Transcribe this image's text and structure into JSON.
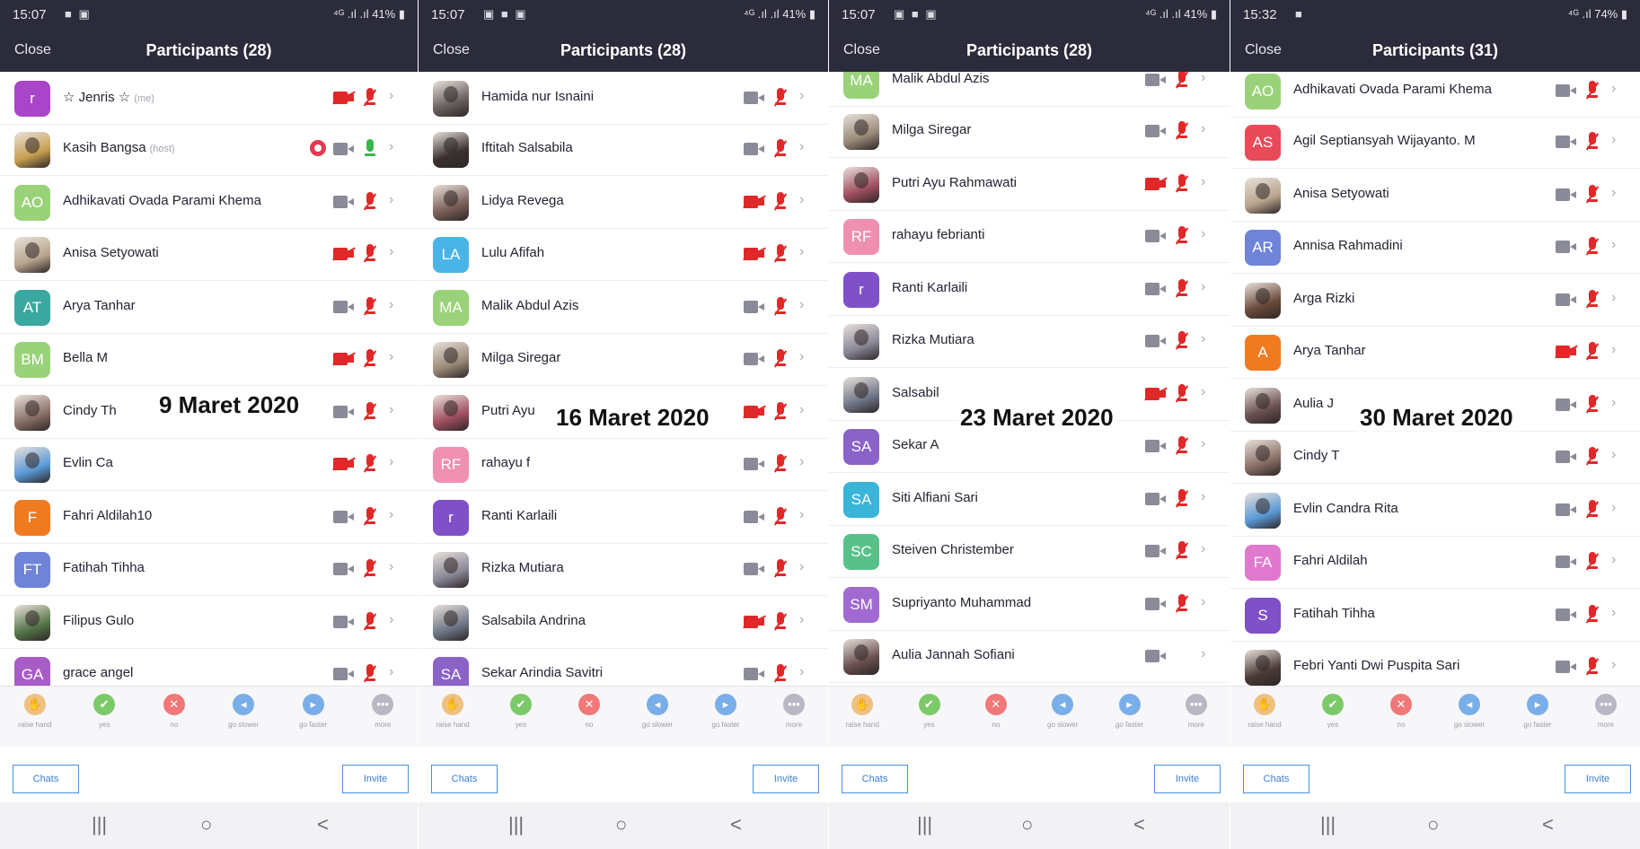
{
  "colors": {
    "header_bg": "#2b2b3b",
    "muted_red": "#e02828",
    "unmuted_green": "#3ab54a",
    "video_gray": "#8a8a98",
    "button_blue": "#3b7fd0",
    "record_red": "#e53950"
  },
  "icons": {
    "video": "video-camera-icon",
    "video_off": "video-camera-off-icon",
    "mic_muted": "microphone-muted-icon",
    "mic_on": "microphone-icon",
    "chevron": "chevron-right-icon",
    "record": "record-icon",
    "home": "home-icon",
    "back": "back-icon",
    "recents": "recents-icon"
  },
  "panels": [
    {
      "status_time": "15:07",
      "status_icons": "■ ▣",
      "status_signal": "⁴ᴳ .ıl .ıl 41% ▮",
      "close_label": "Close",
      "title": "Participants (28)",
      "date_overlay": "9 Maret 2020",
      "participants": [
        {
          "name": "☆ Jenris ☆",
          "tag": "(me)",
          "avatar": "r",
          "color": "#a845c8",
          "video": "off",
          "mic": "muted"
        },
        {
          "name": "Kasih Bangsa",
          "tag": "(host)",
          "avatar": "",
          "color": "#c8a050",
          "video": "on",
          "mic": "on",
          "record": true
        },
        {
          "name": "Adhikavati Ovada Parami Khema",
          "avatar": "AO",
          "color": "#9ad27a",
          "video": "on",
          "mic": "muted"
        },
        {
          "name": "Anisa Setyowati",
          "avatar": "",
          "color": "#b9a58d",
          "video": "off",
          "mic": "muted"
        },
        {
          "name": "Arya Tanhar",
          "avatar": "AT",
          "color": "#3aa8a0",
          "video": "on",
          "mic": "muted"
        },
        {
          "name": "Bella M",
          "avatar": "BM",
          "color": "#9ad27a",
          "video": "off",
          "mic": "muted"
        },
        {
          "name": "Cindy Th",
          "avatar": "",
          "color": "#8a7066",
          "video": "on",
          "mic": "muted"
        },
        {
          "name": "Evlin Ca",
          "avatar": "",
          "color": "#5a9ad8",
          "video": "off",
          "mic": "muted"
        },
        {
          "name": "Fahri Aldilah10",
          "avatar": "F",
          "color": "#f07a20",
          "video": "on",
          "mic": "muted"
        },
        {
          "name": "Fatihah Tihha",
          "avatar": "FT",
          "color": "#6f84d8",
          "video": "on",
          "mic": "muted"
        },
        {
          "name": "Filipus Gulo",
          "avatar": "",
          "color": "#55774a",
          "video": "on",
          "mic": "muted"
        },
        {
          "name": "grace angel",
          "avatar": "GA",
          "color": "#a85cc8",
          "video": "on",
          "mic": "muted"
        }
      ],
      "reactions": [
        "raise hand",
        "yes",
        "no",
        "go slower",
        "go faster",
        "more"
      ],
      "chats_label": "Chats",
      "invite_label": "Invite"
    },
    {
      "status_time": "15:07",
      "status_icons": "▣ ■ ▣",
      "status_signal": "⁴ᴳ .ıl .ıl 41% ▮",
      "close_label": "Close",
      "title": "Participants (28)",
      "date_overlay": "16 Maret 2020",
      "participants": [
        {
          "name": "Hamida nur Isnaini",
          "avatar": "",
          "color": "#6a6060",
          "video": "on",
          "mic": "muted"
        },
        {
          "name": "Iftitah Salsabila",
          "avatar": "",
          "color": "#3a3030",
          "video": "on",
          "mic": "muted"
        },
        {
          "name": "Lidya Revega",
          "avatar": "",
          "color": "#7a6058",
          "video": "off",
          "mic": "muted"
        },
        {
          "name": "Lulu Afifah",
          "avatar": "LA",
          "color": "#4ab4e8",
          "video": "off",
          "mic": "muted"
        },
        {
          "name": "Malik Abdul Azis",
          "avatar": "MA",
          "color": "#9ad27a",
          "video": "on",
          "mic": "muted"
        },
        {
          "name": "Milga Siregar",
          "avatar": "",
          "color": "#9a8a78",
          "video": "on",
          "mic": "muted"
        },
        {
          "name": "Putri Ayu",
          "avatar": "",
          "color": "#a05060",
          "video": "off",
          "mic": "muted"
        },
        {
          "name": "rahayu f",
          "avatar": "RF",
          "color": "#f090b0",
          "video": "on",
          "mic": "muted"
        },
        {
          "name": "Ranti Karlaili",
          "avatar": "r",
          "color": "#8050c8",
          "video": "on",
          "mic": "muted"
        },
        {
          "name": "Rizka Mutiara",
          "avatar": "",
          "color": "#8a8898",
          "video": "on",
          "mic": "muted"
        },
        {
          "name": "Salsabila Andrina",
          "avatar": "",
          "color": "#707888",
          "video": "off",
          "mic": "muted"
        },
        {
          "name": "Sekar Arindia Savitri",
          "avatar": "SA",
          "color": "#8a62c8",
          "video": "on",
          "mic": "muted"
        }
      ],
      "reactions": [
        "raise hand",
        "yes",
        "no",
        "go slower",
        "go faster",
        "more"
      ],
      "chats_label": "Chats",
      "invite_label": "Invite"
    },
    {
      "status_time": "15:07",
      "status_icons": "▣ ■ ▣",
      "status_signal": "⁴ᴳ .ıl .ıl 41% ▮",
      "close_label": "Close",
      "title": "Participants (28)",
      "date_overlay": "23 Maret 2020",
      "participants": [
        {
          "name": "Malik Abdul Azis",
          "avatar": "MA",
          "color": "#9ad27a",
          "video": "on",
          "mic": "muted"
        },
        {
          "name": "Milga Siregar",
          "avatar": "",
          "color": "#9a8a78",
          "video": "on",
          "mic": "muted"
        },
        {
          "name": "Putri Ayu Rahmawati",
          "avatar": "",
          "color": "#a05060",
          "video": "off",
          "mic": "muted"
        },
        {
          "name": "rahayu febrianti",
          "avatar": "RF",
          "color": "#f090b0",
          "video": "on",
          "mic": "muted"
        },
        {
          "name": "Ranti Karlaili",
          "avatar": "r",
          "color": "#8050c8",
          "video": "on",
          "mic": "muted"
        },
        {
          "name": "Rizka Mutiara",
          "avatar": "",
          "color": "#8a8898",
          "video": "on",
          "mic": "muted"
        },
        {
          "name": "Salsabil",
          "avatar": "",
          "color": "#707888",
          "video": "off",
          "mic": "muted"
        },
        {
          "name": "Sekar A",
          "avatar": "SA",
          "color": "#8a62c8",
          "video": "on",
          "mic": "muted"
        },
        {
          "name": "Siti Alfiani Sari",
          "avatar": "SA",
          "color": "#3ab4d8",
          "video": "on",
          "mic": "muted"
        },
        {
          "name": "Steiven Christember",
          "avatar": "SC",
          "color": "#5ac08a",
          "video": "on",
          "mic": "muted"
        },
        {
          "name": "Supriyanto Muhammad",
          "avatar": "SM",
          "color": "#a06ad0",
          "video": "on",
          "mic": "muted"
        },
        {
          "name": "Aulia Jannah Sofiani",
          "avatar": "",
          "color": "#6a5050",
          "video": "on",
          "mic": "none"
        }
      ],
      "reactions": [
        "raise hand",
        "yes",
        "no",
        "go slower",
        "go faster",
        "more"
      ],
      "chats_label": "Chats",
      "invite_label": "Invite"
    },
    {
      "status_time": "15:32",
      "status_icons": "■",
      "status_signal": "⁴ᴳ .ıl 74% ▮",
      "close_label": "Close",
      "title": "Participants (31)",
      "date_overlay": "30 Maret 2020",
      "participants": [
        {
          "name": "Adhikavati Ovada Parami Khema",
          "avatar": "AO",
          "color": "#9ad27a",
          "video": "on",
          "mic": "muted"
        },
        {
          "name": "Agil Septiansyah Wijayanto. M",
          "avatar": "AS",
          "color": "#e84a5a",
          "video": "on",
          "mic": "muted"
        },
        {
          "name": "Anisa Setyowati",
          "avatar": "",
          "color": "#b9a58d",
          "video": "on",
          "mic": "muted"
        },
        {
          "name": "Annisa Rahmadini",
          "avatar": "AR",
          "color": "#6f84d8",
          "video": "on",
          "mic": "muted"
        },
        {
          "name": "Arga Rizki",
          "avatar": "",
          "color": "#6a4a3a",
          "video": "on",
          "mic": "muted"
        },
        {
          "name": "Arya Tanhar",
          "avatar": "A",
          "color": "#f07a20",
          "video": "off",
          "mic": "muted"
        },
        {
          "name": "Aulia J",
          "avatar": "",
          "color": "#6a5050",
          "video": "on",
          "mic": "muted"
        },
        {
          "name": "Cindy T",
          "avatar": "",
          "color": "#8a7066",
          "video": "on",
          "mic": "muted"
        },
        {
          "name": "Evlin Candra Rita",
          "avatar": "",
          "color": "#5a9ad8",
          "video": "on",
          "mic": "muted"
        },
        {
          "name": "Fahri Aldilah",
          "avatar": "FA",
          "color": "#e078d0",
          "video": "on",
          "mic": "muted"
        },
        {
          "name": "Fatihah Tihha",
          "avatar": "S",
          "color": "#8050c8",
          "video": "on",
          "mic": "muted"
        },
        {
          "name": "Febri Yanti Dwi Puspita Sari",
          "avatar": "",
          "color": "#4a3a38",
          "video": "on",
          "mic": "muted"
        }
      ],
      "reactions": [
        "raise hand",
        "yes",
        "no",
        "go slower",
        "go faster",
        "more"
      ],
      "chats_label": "Chats",
      "invite_label": "Invite"
    }
  ],
  "nav": {
    "recents": "|||",
    "home": "○",
    "back": "<"
  }
}
